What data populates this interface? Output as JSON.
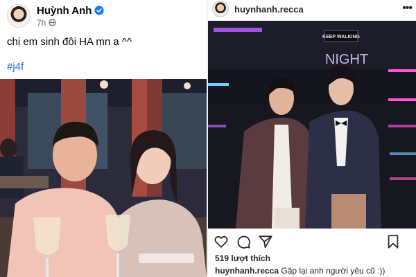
{
  "facebook_post": {
    "author_name": "Huỳnh Anh",
    "time": "7h",
    "caption": "chị em sinh đôi HA mn ạ ^^",
    "hashtag": "#j4f",
    "colors": {
      "link": "#216fdb",
      "verified": "#1877f2",
      "muted": "#65676b"
    }
  },
  "instagram_post": {
    "username": "huynhanh.recca",
    "likes": "519 lượt thích",
    "comment_user": "huynhanh.recca",
    "comment_text": "Gặp lại anh người yêu cũ :))",
    "photo_sign_text": "KEEP WALKING",
    "photo_neon_text": "NIGHT",
    "icons": [
      "heart-icon",
      "comment-icon",
      "share-icon",
      "bookmark-icon",
      "more-icon"
    ]
  }
}
